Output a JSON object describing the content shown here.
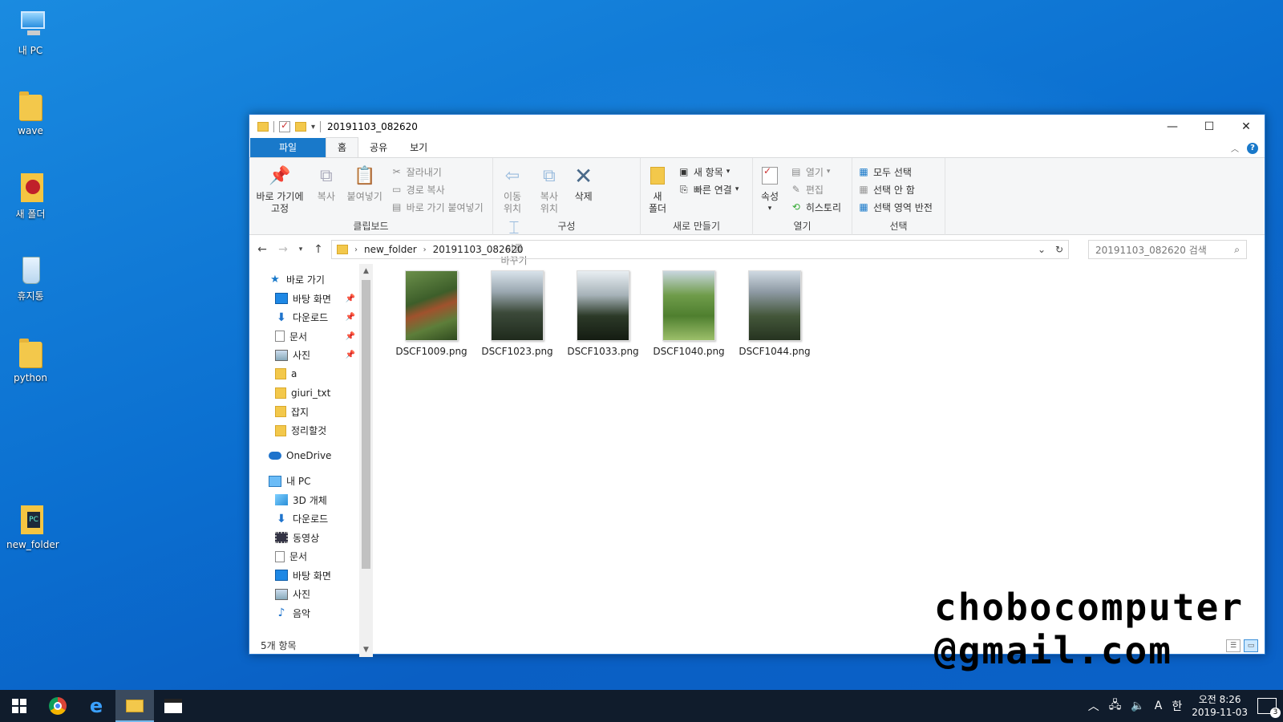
{
  "desktop": {
    "icons": [
      {
        "label": "내 PC"
      },
      {
        "label": "wave"
      },
      {
        "label": "새 폴더"
      },
      {
        "label": "휴지통"
      },
      {
        "label": "python"
      },
      {
        "label": "new_folder"
      }
    ]
  },
  "explorer": {
    "title": "20191103_082620",
    "window_controls": {
      "minimize": "—",
      "maximize": "☐",
      "close": "✕"
    },
    "tabs": [
      {
        "label": "파일"
      },
      {
        "label": "홈"
      },
      {
        "label": "공유"
      },
      {
        "label": "보기"
      }
    ],
    "ribbon": {
      "clipboard": {
        "label": "클립보드",
        "pin_quick_access": "바로 가기에\n고정",
        "copy": "복사",
        "paste": "붙여넣기",
        "cut": "잘라내기",
        "copy_path": "경로 복사",
        "paste_shortcut": "바로 가기 붙여넣기"
      },
      "organize": {
        "label": "구성",
        "move_to": "이동\n위치",
        "copy_to": "복사\n위치",
        "delete": "삭제",
        "rename": "이름\n바꾸기"
      },
      "new": {
        "label": "새로 만들기",
        "new_folder": "새\n폴더",
        "new_item": "새 항목",
        "easy_access": "빠른 연결"
      },
      "open": {
        "label": "열기",
        "properties": "속성",
        "open": "열기",
        "edit": "편집",
        "history": "히스토리"
      },
      "select": {
        "label": "선택",
        "select_all": "모두 선택",
        "select_none": "선택 안 함",
        "invert": "선택 영역 반전"
      }
    },
    "address": {
      "path": [
        "new_folder",
        "20191103_082620"
      ],
      "search_placeholder": "20191103_082620 검색"
    },
    "nav": {
      "quick_access": "바로 가기",
      "quick_items": [
        "바탕 화면",
        "다운로드",
        "문서",
        "사진",
        "a",
        "giuri_txt",
        "잡지",
        "정리할것"
      ],
      "onedrive": "OneDrive",
      "this_pc": "내 PC",
      "pc_items": [
        "3D 개체",
        "다운로드",
        "동영상",
        "문서",
        "바탕 화면",
        "사진",
        "음악"
      ]
    },
    "files": [
      {
        "name": "DSCF1009.png"
      },
      {
        "name": "DSCF1023.png"
      },
      {
        "name": "DSCF1033.png"
      },
      {
        "name": "DSCF1040.png"
      },
      {
        "name": "DSCF1044.png"
      }
    ],
    "status": "5개 항목"
  },
  "watermark": {
    "line1": "chobocomputer",
    "line2": "@gmail.com"
  },
  "taskbar": {
    "ime_mode": "A",
    "ime_lang": "한",
    "time": "오전 8:26",
    "date": "2019-11-03",
    "notification_count": "3"
  }
}
